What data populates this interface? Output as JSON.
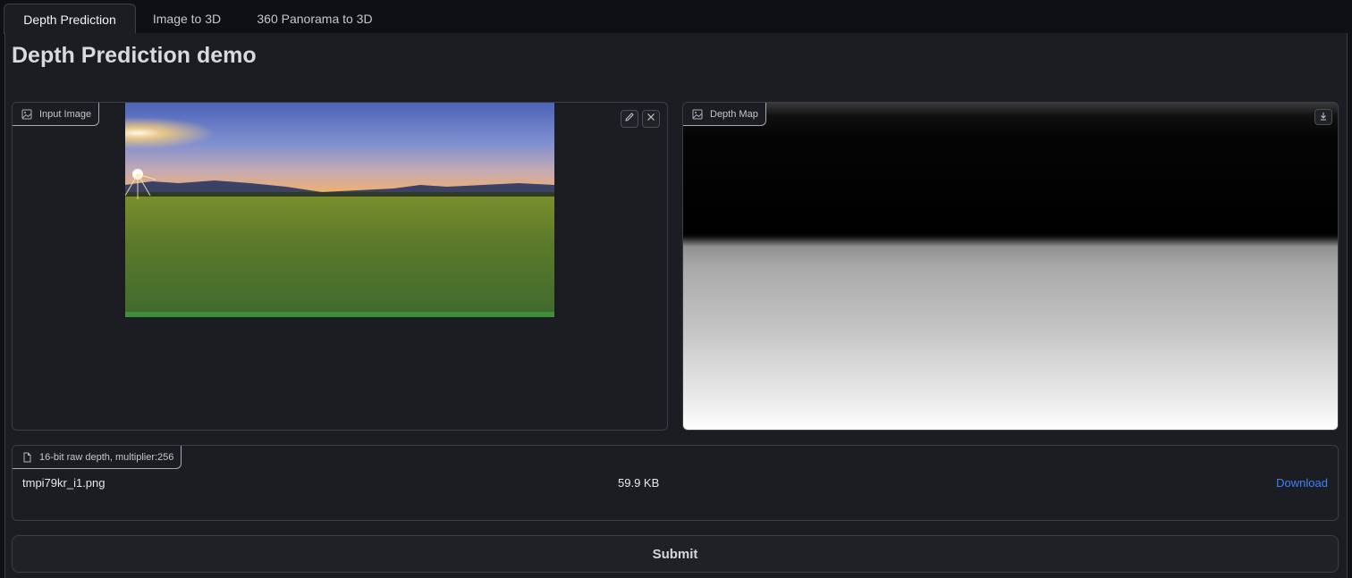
{
  "tabs": [
    {
      "label": "Depth Prediction",
      "active": true
    },
    {
      "label": "Image to 3D",
      "active": false
    },
    {
      "label": "360 Panorama to 3D",
      "active": false
    }
  ],
  "title": "Depth Prediction demo",
  "input_image": {
    "label": "Input Image",
    "icon": "image-icon",
    "tools": [
      "edit-icon",
      "close-icon"
    ]
  },
  "depth_map": {
    "label": "Depth Map",
    "icon": "image-icon",
    "tools": [
      "download-icon"
    ]
  },
  "file_output": {
    "label": "16-bit raw depth, multiplier:256",
    "icon": "file-icon",
    "file_name": "tmpi79kr_i1.png",
    "file_size": "59.9 KB",
    "download_label": "Download"
  },
  "submit_label": "Submit",
  "colors": {
    "background": "#1b1d22",
    "border": "#3b3f46",
    "link": "#3b82f6"
  }
}
